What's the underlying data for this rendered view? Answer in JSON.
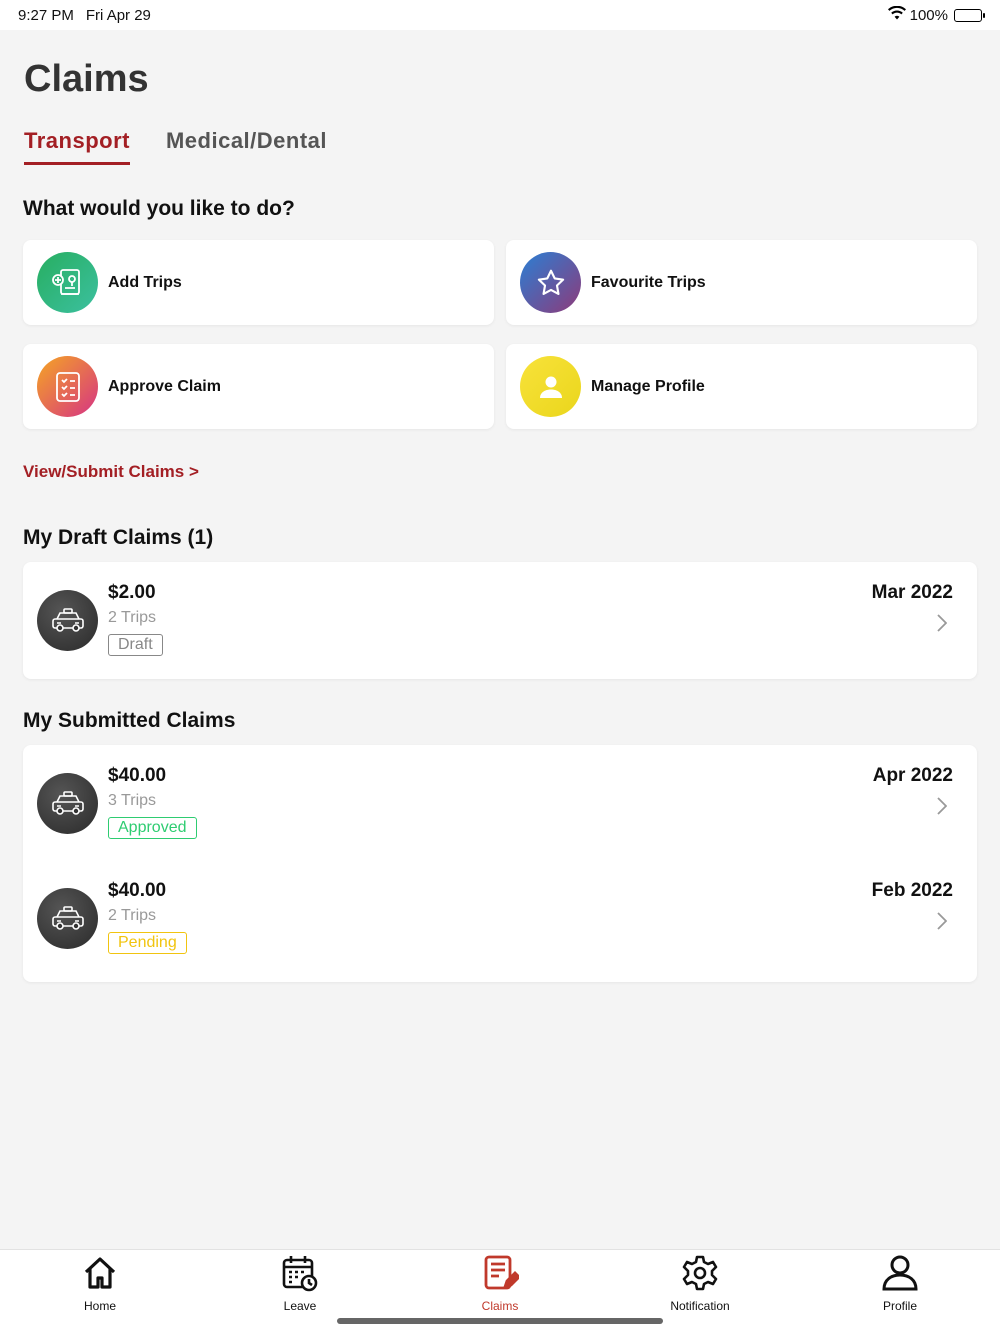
{
  "status_bar": {
    "time": "9:27 PM",
    "date": "Fri Apr 29",
    "battery": "100%"
  },
  "page": {
    "title": "Claims"
  },
  "tabs": [
    {
      "label": "Transport",
      "active": true
    },
    {
      "label": "Medical/Dental",
      "active": false
    }
  ],
  "actions": {
    "heading": "What would you like to do?",
    "items": [
      {
        "label": "Add Trips",
        "icon": "add-trip-icon"
      },
      {
        "label": "Favourite Trips",
        "icon": "star-icon"
      },
      {
        "label": "Approve Claim",
        "icon": "checklist-icon"
      },
      {
        "label": "Manage Profile",
        "icon": "user-icon"
      }
    ]
  },
  "view_submit_link": "View/Submit Claims >",
  "drafts": {
    "heading": "My Draft Claims (1)",
    "items": [
      {
        "amount": "$2.00",
        "trips": "2 Trips",
        "status": "Draft",
        "date": "Mar 2022"
      }
    ]
  },
  "submitted": {
    "heading": "My Submitted Claims",
    "items": [
      {
        "amount": "$40.00",
        "trips": "3 Trips",
        "status": "Approved",
        "date": "Apr 2022"
      },
      {
        "amount": "$40.00",
        "trips": "2 Trips",
        "status": "Pending",
        "date": "Feb 2022"
      }
    ]
  },
  "nav": [
    {
      "label": "Home",
      "icon": "home-icon"
    },
    {
      "label": "Leave",
      "icon": "calendar-clock-icon"
    },
    {
      "label": "Claims",
      "icon": "claims-icon",
      "active": true
    },
    {
      "label": "Notification",
      "icon": "gear-icon"
    },
    {
      "label": "Profile",
      "icon": "profile-icon"
    }
  ],
  "colors": {
    "accent": "#a31f24",
    "approved": "#2ecc71",
    "pending": "#f1c40f",
    "draft": "#888888"
  }
}
